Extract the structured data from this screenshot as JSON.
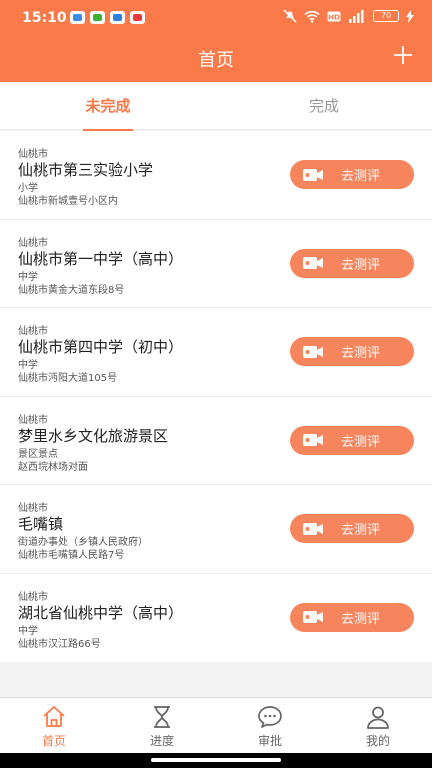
{
  "status_bar": {
    "time": "15:10",
    "battery": "70",
    "icons": [
      "mute-icon",
      "wifi-icon",
      "hd-icon",
      "signal-icon",
      "battery-icon",
      "charging-icon"
    ]
  },
  "header": {
    "title": "首页",
    "add_icon": "plus-icon"
  },
  "tabs": [
    {
      "label": "未完成",
      "active": true
    },
    {
      "label": "完成",
      "active": false
    }
  ],
  "items": [
    {
      "region": "仙桃市",
      "name": "仙桃市第三实验小学",
      "type": "小学",
      "address": "仙桃市新城壹号小区内",
      "action": "去测评"
    },
    {
      "region": "仙桃市",
      "name": "仙桃市第一中学（高中）",
      "type": "中学",
      "address": "仙桃市黄金大道东段8号",
      "action": "去测评"
    },
    {
      "region": "仙桃市",
      "name": "仙桃市第四中学（初中）",
      "type": "中学",
      "address": "仙桃市沔阳大道105号",
      "action": "去测评"
    },
    {
      "region": "仙桃市",
      "name": "梦里水乡文化旅游景区",
      "type": "景区景点",
      "address": "赵西垸林场对面",
      "action": "去测评"
    },
    {
      "region": "仙桃市",
      "name": "毛嘴镇",
      "type": "街道办事处（乡镇人民政府）",
      "address": "仙桃市毛嘴镇人民路7号",
      "action": "去测评"
    },
    {
      "region": "仙桃市",
      "name": "湖北省仙桃中学（高中）",
      "type": "中学",
      "address": "仙桃市汉江路66号",
      "action": "去测评"
    }
  ],
  "bottom_nav": [
    {
      "label": "首页",
      "icon": "home-icon",
      "active": true
    },
    {
      "label": "进度",
      "icon": "hourglass-icon",
      "active": false
    },
    {
      "label": "审批",
      "icon": "chat-icon",
      "active": false
    },
    {
      "label": "我的",
      "icon": "user-icon",
      "active": false
    }
  ],
  "colors": {
    "accent": "#fb7a4a",
    "button": "#f6845c"
  }
}
